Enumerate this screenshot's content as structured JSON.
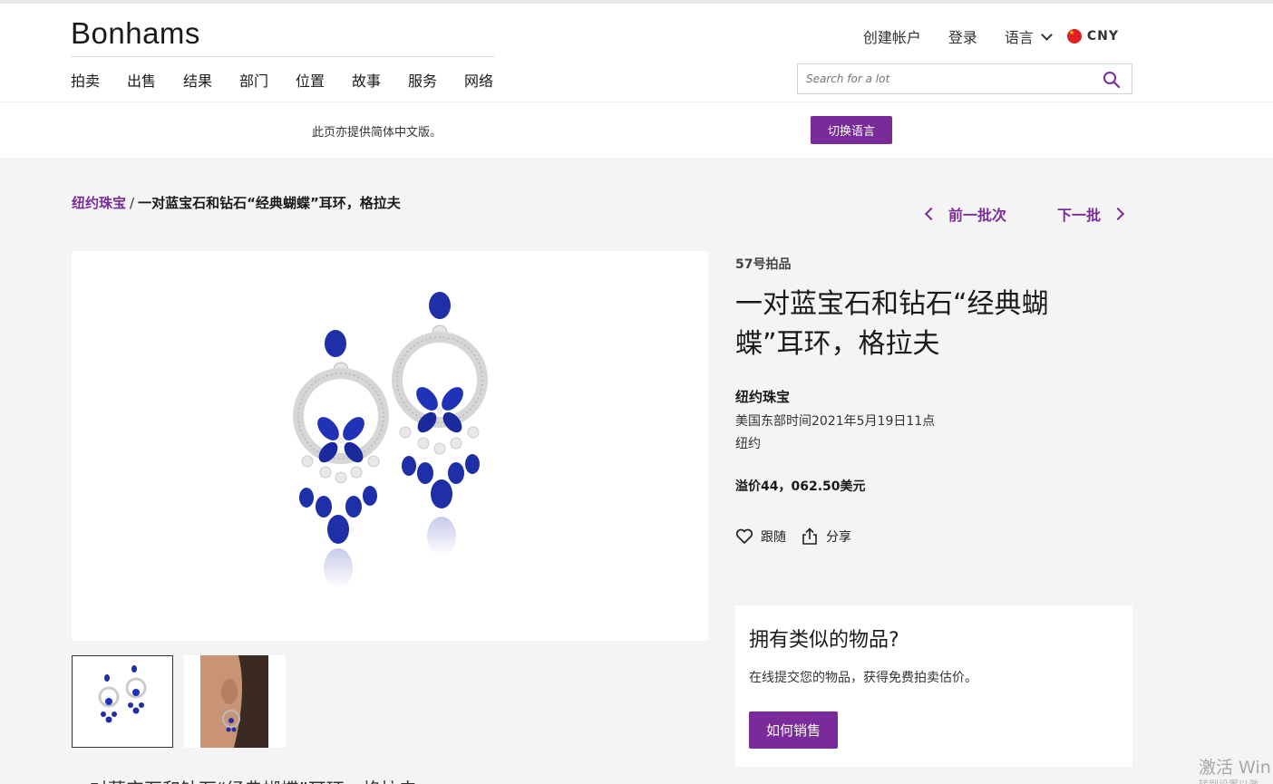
{
  "header": {
    "logo": "Bonhams",
    "nav": [
      "拍卖",
      "出售",
      "结果",
      "部门",
      "位置",
      "故事",
      "服务",
      "网络"
    ],
    "create_account": "创建帐户",
    "login": "登录",
    "language": "语言",
    "currency": "CNY",
    "search_placeholder": "Search for a lot"
  },
  "language_bar": {
    "text": "此页亦提供简体中文版。",
    "button": "切换语言"
  },
  "breadcrumb": {
    "link": "纽约珠宝",
    "separator": "/",
    "current": "一对蓝宝石和钻石“经典蝴蝶”耳环，格拉夫"
  },
  "pager": {
    "prev": "前一批次",
    "next": "下一批"
  },
  "lot": {
    "number": "57号拍品",
    "title": "一对蓝宝石和钻石“经典蝴蝶”耳环，格拉夫",
    "sale_name": "纽约珠宝",
    "sale_date": "美国东部时间2021年5月19日11点",
    "location": "纽约",
    "premium": "溢价44，062.50美元",
    "follow": "跟随",
    "share": "分享"
  },
  "sell_card": {
    "title": "拥有类似的物品?",
    "text": "在线提交您的物品，获得免费拍卖估价。",
    "button": "如何销售"
  },
  "below_text": "一对蓝宝石和钻石“经典蝴蝶”耳环，格拉夫",
  "watermark": {
    "line1": "激活 Win",
    "line2": "转到设置以激"
  },
  "colors": {
    "accent": "#7a2b9a",
    "sapphire": "#1f2fa8",
    "background": "#f4f4f4"
  }
}
